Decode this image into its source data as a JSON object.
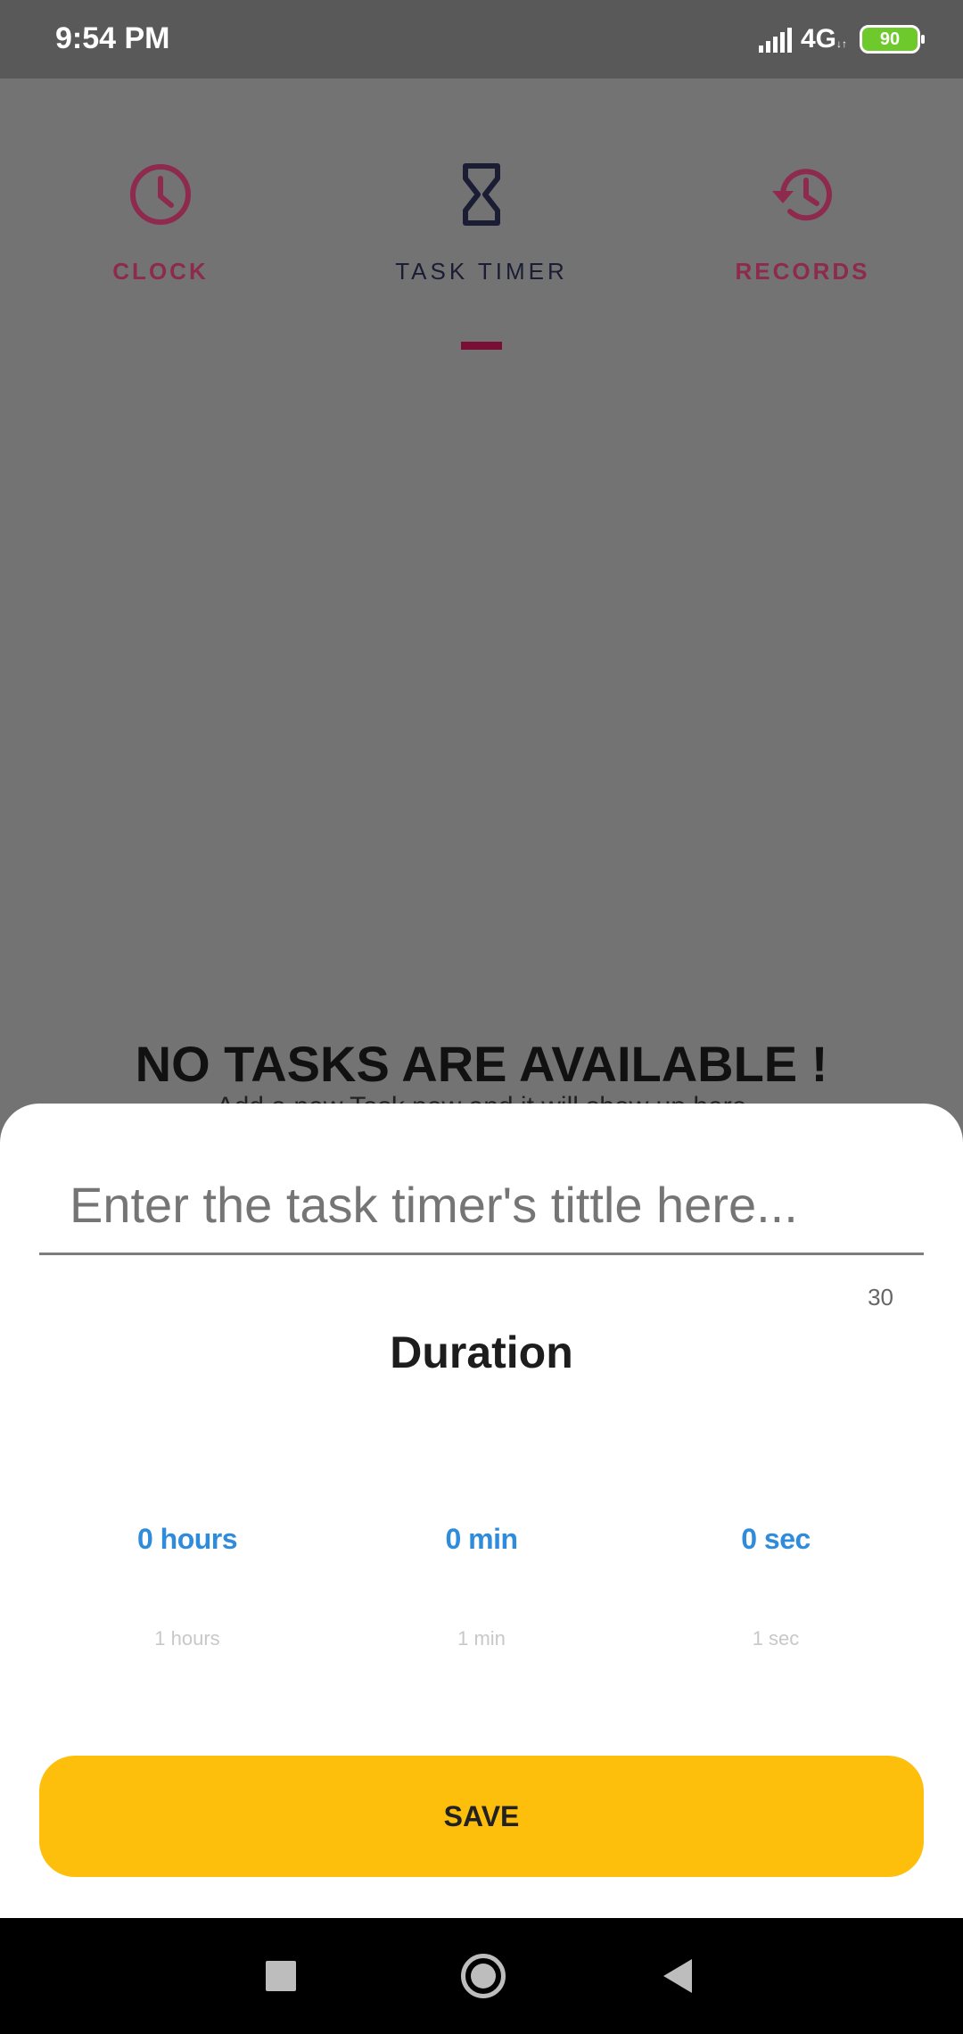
{
  "status_bar": {
    "time": "9:54 PM",
    "network": "4G",
    "battery": "90"
  },
  "tabs": [
    {
      "label": "CLOCK",
      "icon": "clock-icon"
    },
    {
      "label": "TASK TIMER",
      "icon": "hourglass-icon"
    },
    {
      "label": "RECORDS",
      "icon": "history-icon"
    }
  ],
  "empty_state": {
    "title": "NO TASKS ARE AVAILABLE !",
    "subtitle": "Add a new Task now and it will show up here"
  },
  "sheet": {
    "input_placeholder": "Enter the task timer's tittle here...",
    "char_counter": "30",
    "duration_title": "Duration",
    "pickers": {
      "hours": {
        "selected": "0 hours",
        "next": "1 hours"
      },
      "minutes": {
        "selected": "0 min",
        "next": "1 min"
      },
      "seconds": {
        "selected": "0 sec",
        "next": "1 sec"
      }
    },
    "save_label": "SAVE"
  },
  "colors": {
    "accent": "#8e2a4d",
    "indicator": "#7a0f36",
    "picker_blue": "#2f8bdc",
    "save_yellow": "#fdbf0c"
  }
}
